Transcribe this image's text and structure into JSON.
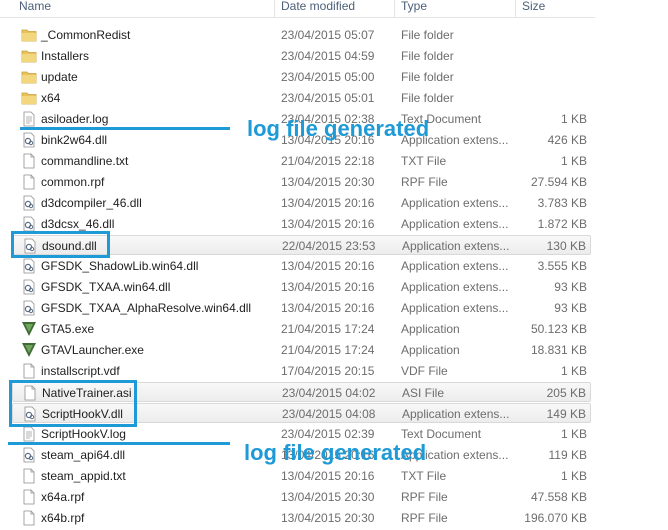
{
  "columns": {
    "name": "Name",
    "date": "Date modified",
    "type": "Type",
    "size": "Size"
  },
  "files": [
    {
      "name": "_CommonRedist",
      "date": "23/04/2015 05:07",
      "type": "File folder",
      "size": "",
      "icon": "folder-icon"
    },
    {
      "name": "Installers",
      "date": "23/04/2015 04:59",
      "type": "File folder",
      "size": "",
      "icon": "folder-icon"
    },
    {
      "name": "update",
      "date": "23/04/2015 05:00",
      "type": "File folder",
      "size": "",
      "icon": "folder-icon"
    },
    {
      "name": "x64",
      "date": "23/04/2015 05:01",
      "type": "File folder",
      "size": "",
      "icon": "folder-icon"
    },
    {
      "name": "asiloader.log",
      "date": "23/04/2015 02:38",
      "type": "Text Document",
      "size": "1 KB",
      "icon": "text-file-icon"
    },
    {
      "name": "bink2w64.dll",
      "date": "13/04/2015 20:16",
      "type": "Application extens...",
      "size": "426 KB",
      "icon": "dll-icon"
    },
    {
      "name": "commandline.txt",
      "date": "21/04/2015 22:18",
      "type": "TXT File",
      "size": "1 KB",
      "icon": "blank-file-icon"
    },
    {
      "name": "common.rpf",
      "date": "13/04/2015 20:30",
      "type": "RPF File",
      "size": "27.594 KB",
      "icon": "blank-file-icon"
    },
    {
      "name": "d3dcompiler_46.dll",
      "date": "13/04/2015 20:16",
      "type": "Application extens...",
      "size": "3.783 KB",
      "icon": "dll-icon"
    },
    {
      "name": "d3dcsx_46.dll",
      "date": "13/04/2015 20:16",
      "type": "Application extens...",
      "size": "1.872 KB",
      "icon": "dll-icon"
    },
    {
      "name": "dsound.dll",
      "date": "22/04/2015 23:53",
      "type": "Application extens...",
      "size": "130 KB",
      "icon": "dll-icon"
    },
    {
      "name": "GFSDK_ShadowLib.win64.dll",
      "date": "13/04/2015 20:16",
      "type": "Application extens...",
      "size": "3.555 KB",
      "icon": "dll-icon"
    },
    {
      "name": "GFSDK_TXAA.win64.dll",
      "date": "13/04/2015 20:16",
      "type": "Application extens...",
      "size": "93 KB",
      "icon": "dll-icon"
    },
    {
      "name": "GFSDK_TXAA_AlphaResolve.win64.dll",
      "date": "13/04/2015 20:16",
      "type": "Application extens...",
      "size": "93 KB",
      "icon": "dll-icon"
    },
    {
      "name": "GTA5.exe",
      "date": "21/04/2015 17:24",
      "type": "Application",
      "size": "50.123 KB",
      "icon": "gta-v-icon"
    },
    {
      "name": "GTAVLauncher.exe",
      "date": "21/04/2015 17:24",
      "type": "Application",
      "size": "18.831 KB",
      "icon": "gta-v-icon"
    },
    {
      "name": "installscript.vdf",
      "date": "17/04/2015 20:15",
      "type": "VDF File",
      "size": "1 KB",
      "icon": "blank-file-icon"
    },
    {
      "name": "NativeTrainer.asi",
      "date": "23/04/2015 04:02",
      "type": "ASI File",
      "size": "205 KB",
      "icon": "blank-file-icon"
    },
    {
      "name": "ScriptHookV.dll",
      "date": "23/04/2015 04:08",
      "type": "Application extens...",
      "size": "149 KB",
      "icon": "dll-icon"
    },
    {
      "name": "ScriptHookV.log",
      "date": "23/04/2015 02:39",
      "type": "Text Document",
      "size": "1 KB",
      "icon": "text-file-icon"
    },
    {
      "name": "steam_api64.dll",
      "date": "13/04/2015 20:16",
      "type": "Application extens...",
      "size": "119 KB",
      "icon": "dll-icon"
    },
    {
      "name": "steam_appid.txt",
      "date": "13/04/2015 20:16",
      "type": "TXT File",
      "size": "1 KB",
      "icon": "blank-file-icon"
    },
    {
      "name": "x64a.rpf",
      "date": "13/04/2015 20:30",
      "type": "RPF File",
      "size": "47.558 KB",
      "icon": "blank-file-icon"
    },
    {
      "name": "x64b.rpf",
      "date": "13/04/2015 20:30",
      "type": "RPF File",
      "size": "196.070 KB",
      "icon": "blank-file-icon"
    }
  ],
  "highlighted_rows": [
    "dsound.dll",
    "NativeTrainer.asi",
    "ScriptHookV.dll"
  ],
  "annotations": {
    "top": "log file generated",
    "bottom": "log file generated"
  },
  "colors": {
    "accent": "#1e9ad6",
    "folder": "#e8c25a",
    "header_text": "#4c607a"
  }
}
